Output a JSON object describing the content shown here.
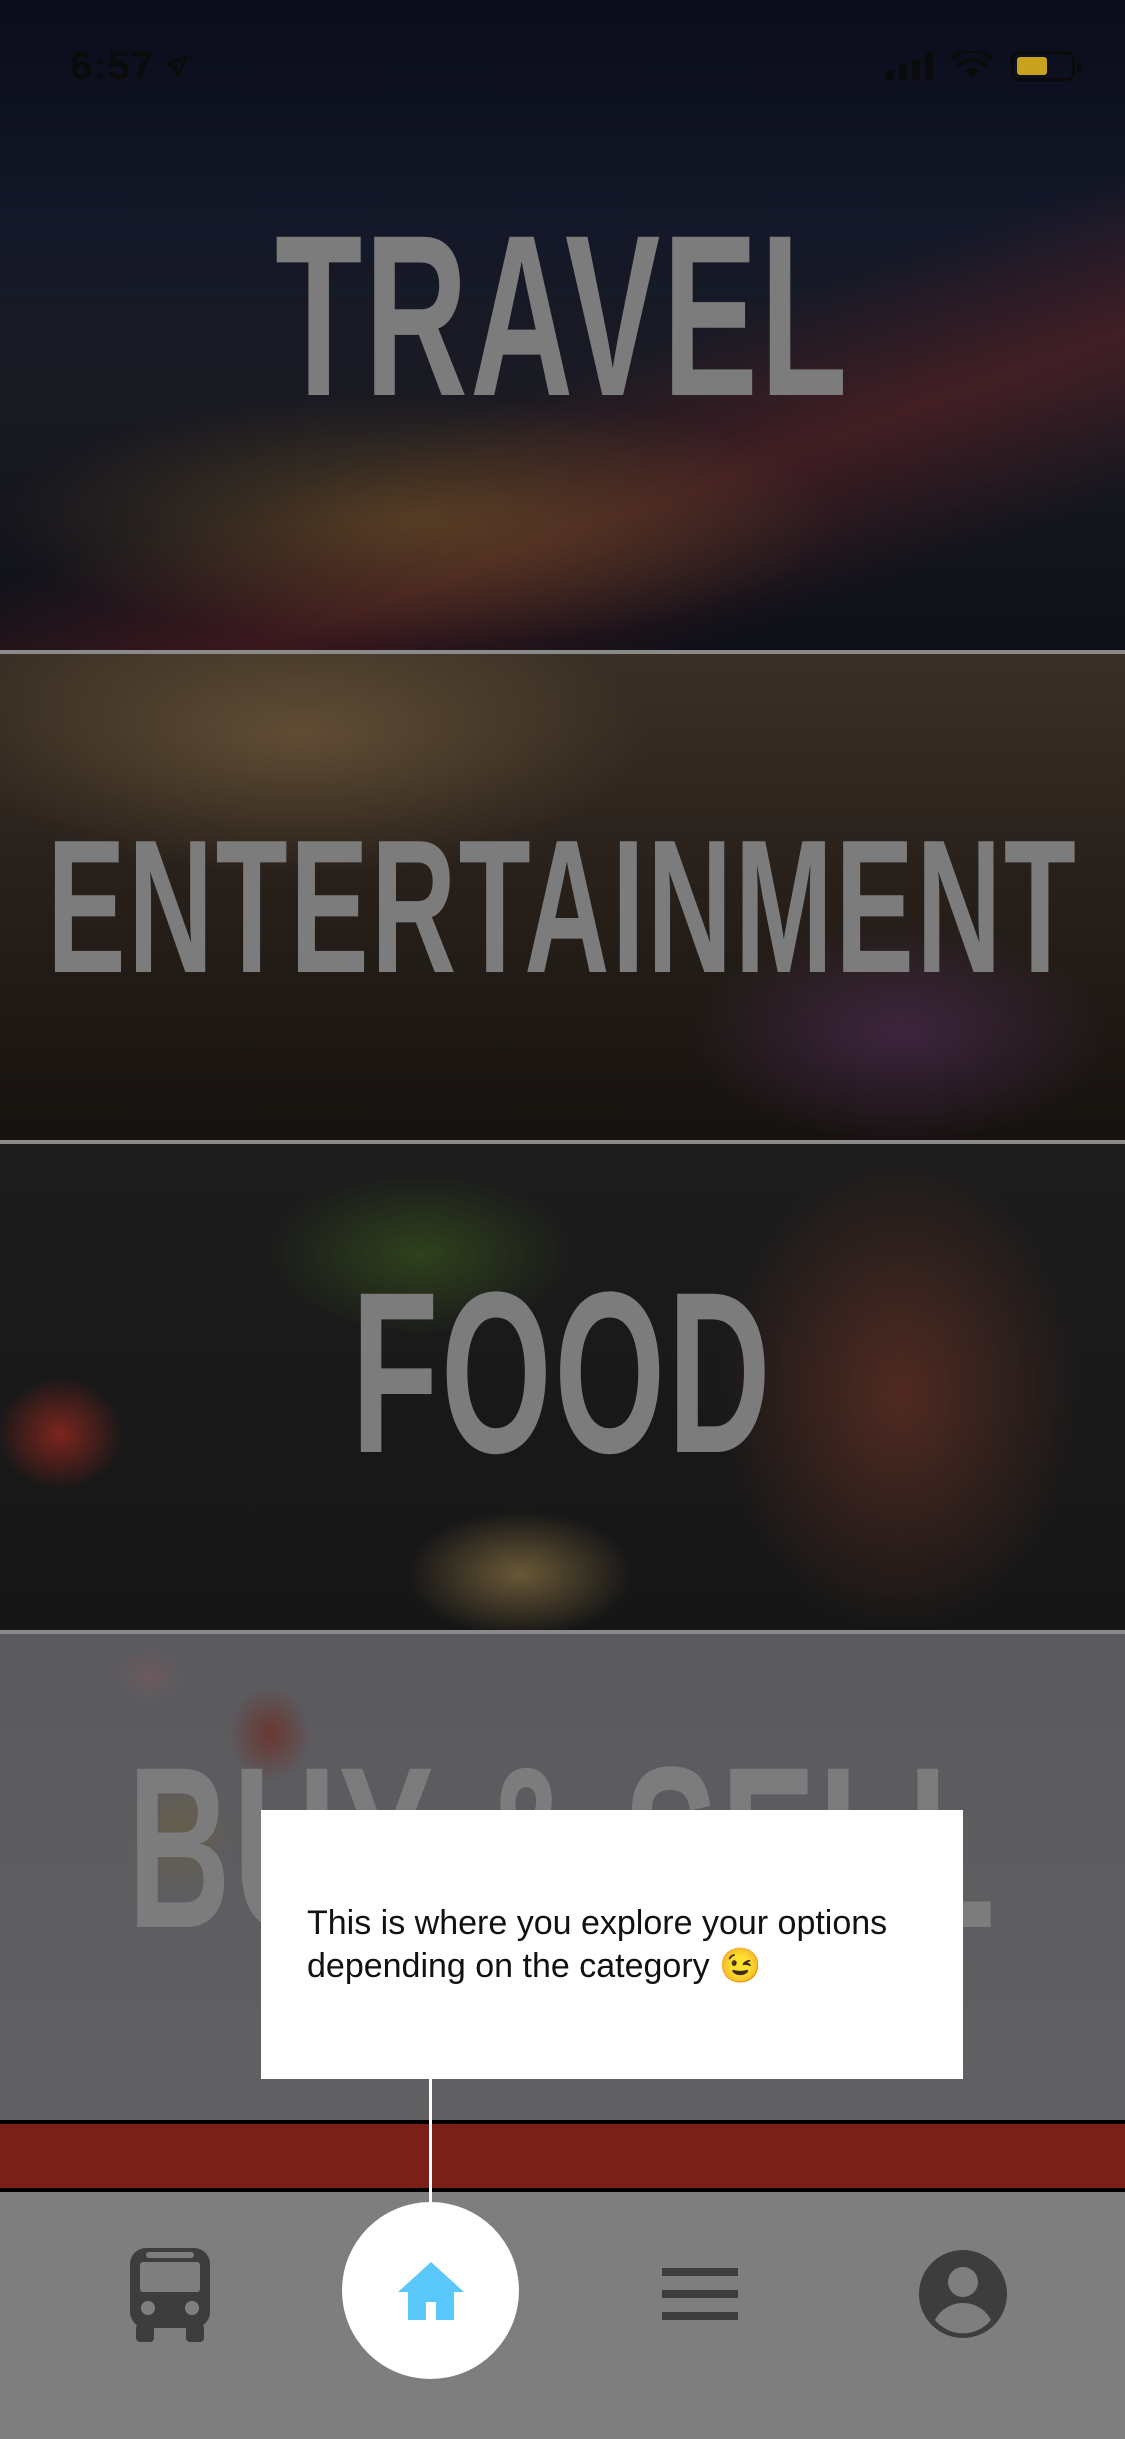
{
  "status_bar": {
    "time": "6:57"
  },
  "categories": [
    {
      "id": "travel",
      "label": "TRAVEL"
    },
    {
      "id": "entertainment",
      "label": "ENTERTAINMENT"
    },
    {
      "id": "food",
      "label": "FOOD"
    },
    {
      "id": "buy-sell",
      "label": "BUY & SELL"
    }
  ],
  "tooltip": {
    "text": "This is where you explore your options depending on the category 😉"
  },
  "bottom_nav": {
    "items": [
      {
        "icon": "bus-icon"
      },
      {
        "icon": "home-icon",
        "active": true
      },
      {
        "icon": "menu-icon"
      },
      {
        "icon": "profile-icon"
      }
    ]
  },
  "colors": {
    "nav_background": "#7e7e7e",
    "active_icon": "#5ac8fa",
    "inactive_icon": "#3d3d3d",
    "accent_strip": "#7a2019",
    "category_label": "#7c7c7c"
  }
}
